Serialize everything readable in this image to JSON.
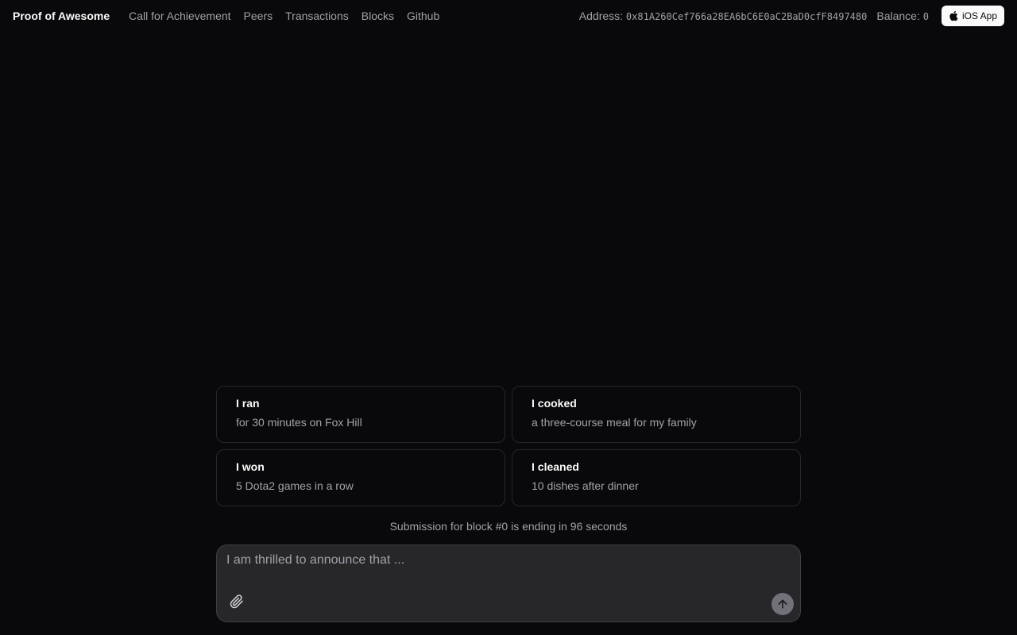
{
  "header": {
    "brand": "Proof of Awesome",
    "nav": [
      {
        "label": "Call for Achievement"
      },
      {
        "label": "Peers"
      },
      {
        "label": "Transactions"
      },
      {
        "label": "Blocks"
      },
      {
        "label": "Github"
      }
    ],
    "address_label": "Address:",
    "address_value": "0x81A260Cef766a28EA6bC6E0aC2BaD0cfF8497480",
    "balance_label": "Balance:",
    "balance_value": "0",
    "ios_button": {
      "label": "iOS App",
      "icon": "apple-icon"
    }
  },
  "suggestions": [
    {
      "title": "I ran",
      "subtitle": "for 30 minutes on Fox Hill"
    },
    {
      "title": "I cooked",
      "subtitle": "a three-course meal for my family"
    },
    {
      "title": "I won",
      "subtitle": "5 Dota2 games in a row"
    },
    {
      "title": "I cleaned",
      "subtitle": "10 dishes after dinner"
    }
  ],
  "status": {
    "text": "Submission for block #0 is ending in 96 seconds"
  },
  "composer": {
    "placeholder": "I am thrilled to announce that ...",
    "value": "",
    "attach_icon": "paperclip-icon",
    "send_icon": "arrow-up-icon"
  },
  "colors": {
    "background": "#09090b",
    "text": "#fafafa",
    "muted": "#a1a1aa",
    "border": "#27272a",
    "composer_bg": "#27272a",
    "send_bg": "#71717a"
  }
}
